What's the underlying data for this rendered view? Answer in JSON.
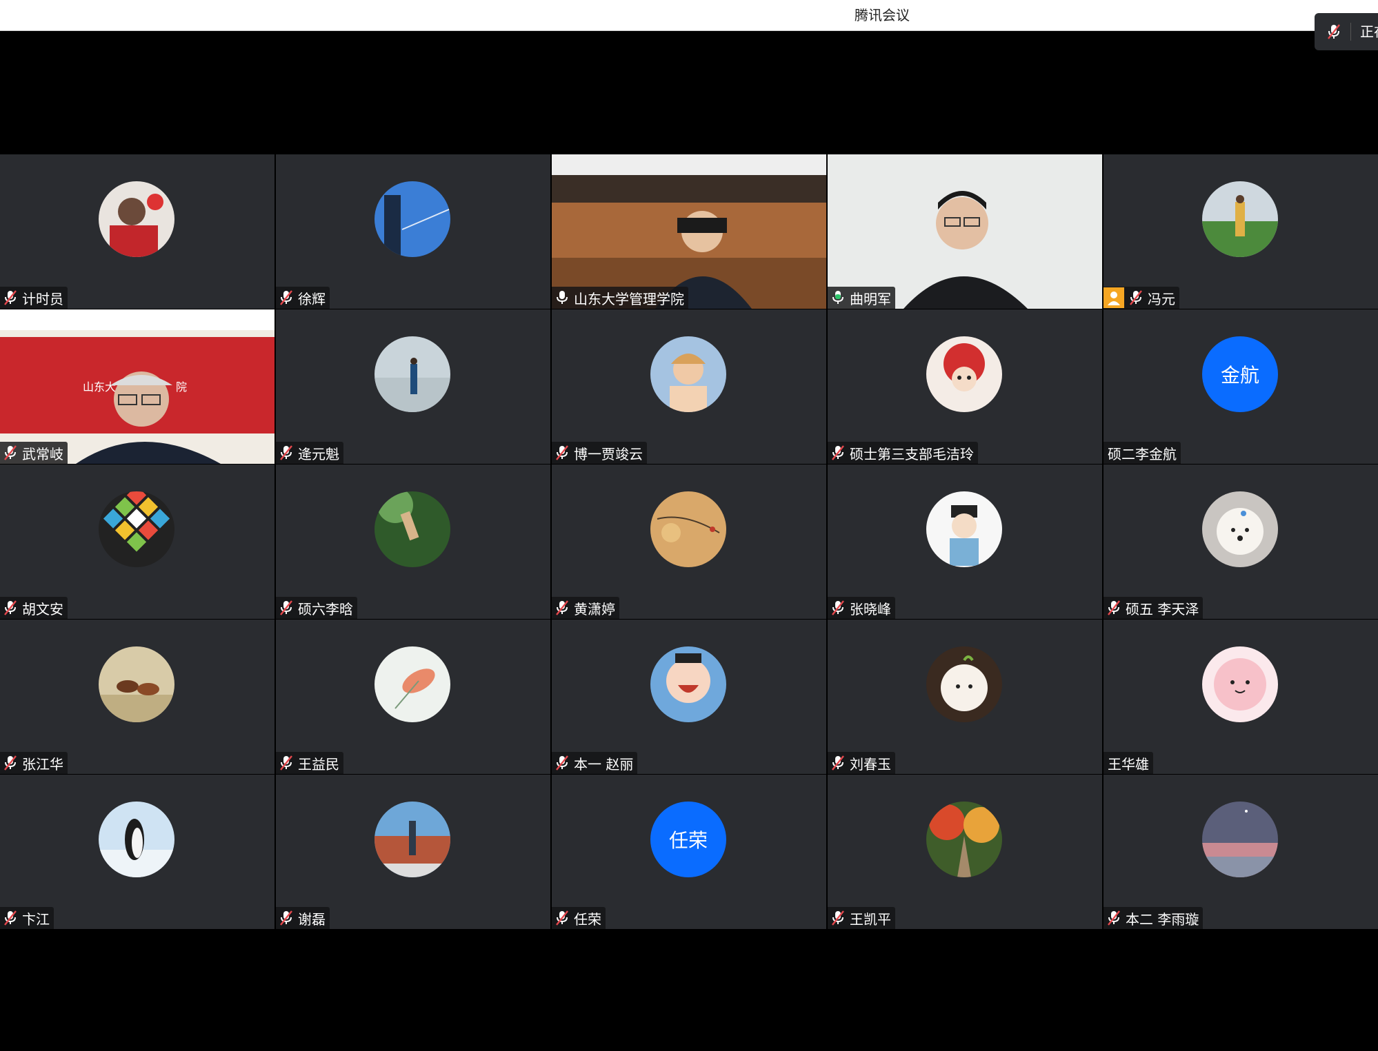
{
  "window": {
    "title": "腾讯会议",
    "speaking_indicator": "正在"
  },
  "colors": {
    "tile_bg": "#2a2c30",
    "active_speaker_border": "#2ec46b",
    "text_avatar_bg": "#0a6cff",
    "host_badge": "#f5a623"
  },
  "participants": [
    {
      "name": "计时员",
      "mic": "muted",
      "avatar": "photo-person-red-sweater"
    },
    {
      "name": "徐辉",
      "mic": "muted",
      "avatar": "photo-building-sky"
    },
    {
      "name": "山东大学管理学院",
      "mic": "on",
      "avatar": "video-conference-room"
    },
    {
      "name": "曲明军",
      "mic": "speaking",
      "avatar": "video-man-glasses",
      "active": true
    },
    {
      "name": "冯元",
      "mic": "muted",
      "avatar": "photo-person-outdoor",
      "host": true
    },
    {
      "name": "武常岐",
      "mic": "muted",
      "avatar": "video-elderly-man-red-backdrop"
    },
    {
      "name": "逄元魁",
      "mic": "muted",
      "avatar": "photo-person-seaside"
    },
    {
      "name": "博一贾竣云",
      "mic": "muted",
      "avatar": "photo-girl-blue"
    },
    {
      "name": "硕士第三支部毛洁玲",
      "mic": "muted",
      "avatar": "cartoon-lion-dance-girl"
    },
    {
      "name": "硕二李金航",
      "mic": "none",
      "avatar_text": "金航"
    },
    {
      "name": "胡文安",
      "mic": "muted",
      "avatar": "pattern-colorful-tiles"
    },
    {
      "name": "硕六李晗",
      "mic": "muted",
      "avatar": "photo-person-jump-park"
    },
    {
      "name": "黄潇婷",
      "mic": "muted",
      "avatar": "painting-branches-moon"
    },
    {
      "name": "张晓峰",
      "mic": "muted",
      "avatar": "cartoon-scholar-boy"
    },
    {
      "name": "硕五 李天泽",
      "mic": "muted",
      "avatar": "photo-white-puppy"
    },
    {
      "name": "张江华",
      "mic": "muted",
      "avatar": "photo-horses-running"
    },
    {
      "name": "王益民",
      "mic": "muted",
      "avatar": "photo-soft-leaf"
    },
    {
      "name": "本一 赵丽",
      "mic": "muted",
      "avatar": "cartoon-laughing-kid"
    },
    {
      "name": "刘春玉",
      "mic": "muted",
      "avatar": "cartoon-white-dumpling"
    },
    {
      "name": "王华雄",
      "mic": "none",
      "avatar": "cartoon-pink-blob"
    },
    {
      "name": "卞江",
      "mic": "muted",
      "avatar": "photo-penguin"
    },
    {
      "name": "谢磊",
      "mic": "muted",
      "avatar": "photo-statue-building"
    },
    {
      "name": "任荣",
      "mic": "muted",
      "avatar_text": "任荣"
    },
    {
      "name": "王凯平",
      "mic": "muted",
      "avatar": "photo-autumn-path"
    },
    {
      "name": "本二 李雨璇",
      "mic": "muted",
      "avatar": "photo-dusk-sky"
    }
  ]
}
